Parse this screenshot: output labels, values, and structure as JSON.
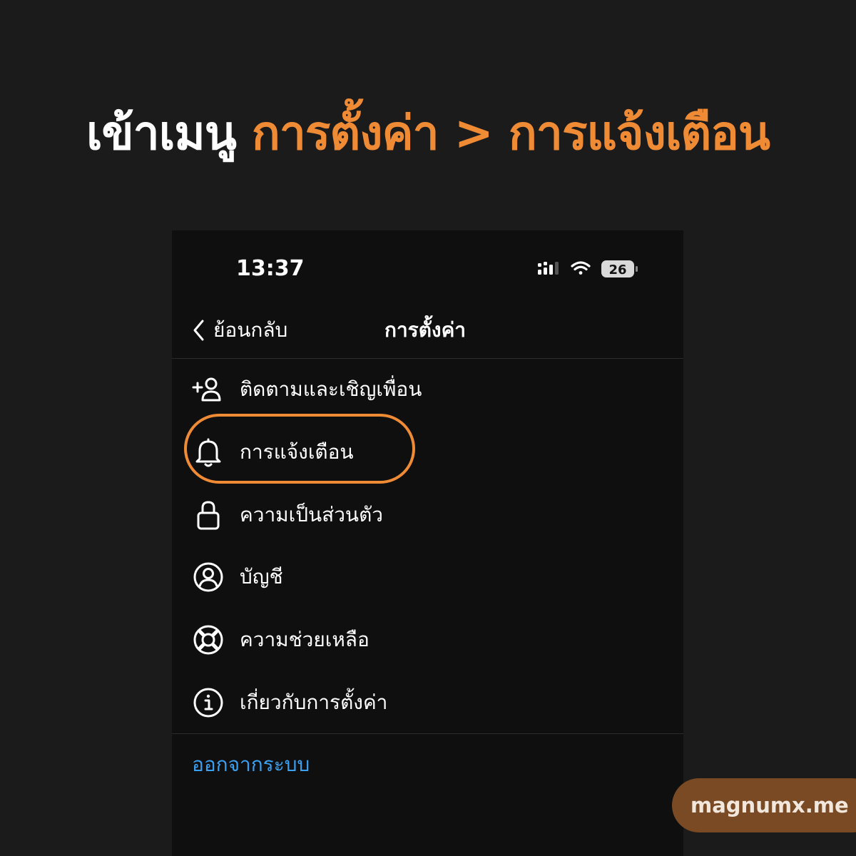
{
  "headline": {
    "prefix": "เข้าเมนู",
    "path": "การตั้งค่า > การแจ้งเตือน",
    "prefix_color": "#ffffff",
    "path_color": "#f08b35"
  },
  "status_bar": {
    "time": "13:37",
    "battery_level": "26",
    "icons": [
      "cellular-signal-icon",
      "wifi-icon",
      "battery-icon"
    ]
  },
  "nav": {
    "back_label": "ย้อนกลับ",
    "title": "การตั้งค่า"
  },
  "menu": {
    "items": [
      {
        "label": "ติดตามและเชิญเพื่อน",
        "icon": "add-person-icon"
      },
      {
        "label": "การแจ้งเตือน",
        "icon": "bell-icon",
        "highlighted": true
      },
      {
        "label": "ความเป็นส่วนตัว",
        "icon": "lock-icon"
      },
      {
        "label": "บัญชี",
        "icon": "account-circle-icon"
      },
      {
        "label": "ความช่วยเหลือ",
        "icon": "lifebuoy-icon"
      },
      {
        "label": "เกี่ยวกับการตั้งค่า",
        "icon": "info-icon"
      }
    ],
    "logout_label": "ออกจากระบบ"
  },
  "colors": {
    "accent": "#f08b35",
    "link": "#3aa0f0",
    "background": "#1b1b1b",
    "screen": "#0f0f0f"
  },
  "watermark": "magnumx.me"
}
